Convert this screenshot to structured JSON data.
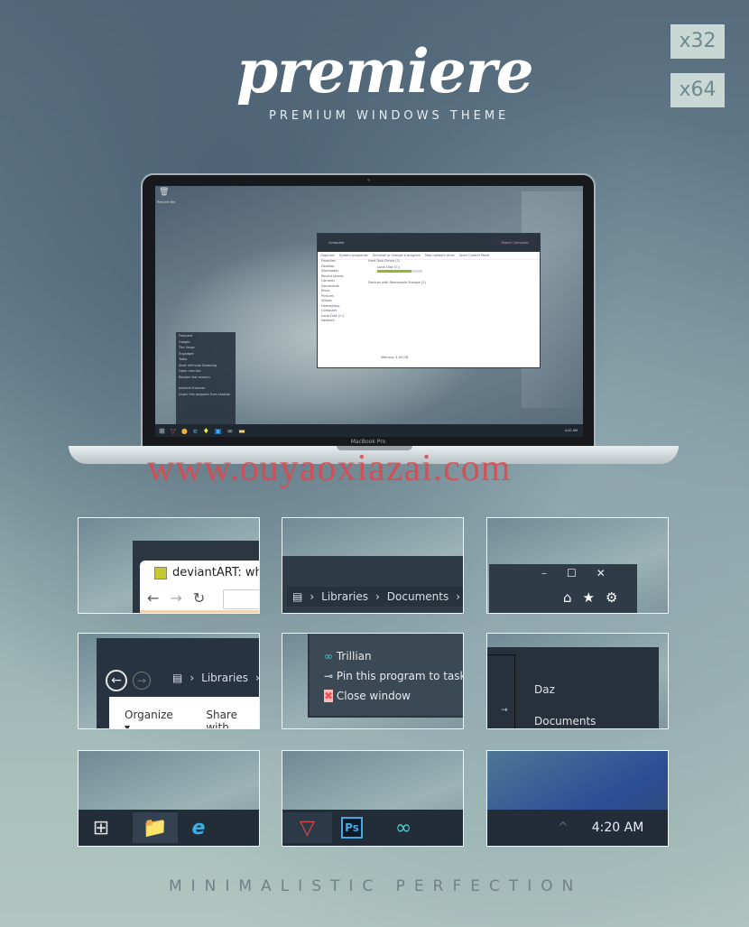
{
  "header": {
    "logo": "premiere",
    "tagline": "PREMIUM WINDOWS THEME",
    "arch_badges": [
      "x32",
      "x64"
    ]
  },
  "laptop": {
    "brand": "MacBook Pro",
    "desktop_icon": "Recycle Bin",
    "clock": "4:20 AM",
    "explorer": {
      "breadcrumb": "Computer",
      "search": "Search Computer",
      "toolbar": [
        "Organize",
        "System properties",
        "Uninstall or change a program",
        "Map network drive",
        "Open Control Panel"
      ],
      "nav": [
        "Favorites",
        "Desktop",
        "Downloads",
        "Recent places",
        "Libraries",
        "Documents",
        "Music",
        "Pictures",
        "Videos",
        "Homegroup",
        "Computer",
        "Local Disk (C:)",
        "Network"
      ],
      "sections": [
        "Hard Disk Drives (1)",
        "Devices with Removable Storage (2)"
      ],
      "drive": "Local Disk (C:)",
      "drive_used_fraction": 0.75,
      "status": "Memory: 4.00 GB"
    },
    "jumplist": {
      "frequent_header": "Frequent",
      "tasks_header": "Tasks",
      "items": [
        "Google",
        "The Verge",
        "Engadget"
      ],
      "tasks": [
        "Start InPrivate Browsing",
        "Open new tab",
        "Reopen last session"
      ],
      "footer": [
        "Internet Explorer",
        "Unpin this program from taskbar"
      ]
    }
  },
  "watermark": "www.ouyaoxiazai.com",
  "tiles": {
    "browser_tab": "deviantART: where",
    "breadcrumb": [
      "Libraries",
      "Documents"
    ],
    "nav_breadcrumb": "Libraries",
    "commands": [
      "Organize",
      "Share with"
    ],
    "context_menu": [
      "Trillian",
      "Pin this program to taskb",
      "Close window"
    ],
    "nav_pane": [
      "Daz",
      "Documents"
    ],
    "clock": "4:20 AM"
  },
  "footer": "MINIMALISTIC PERFECTION"
}
